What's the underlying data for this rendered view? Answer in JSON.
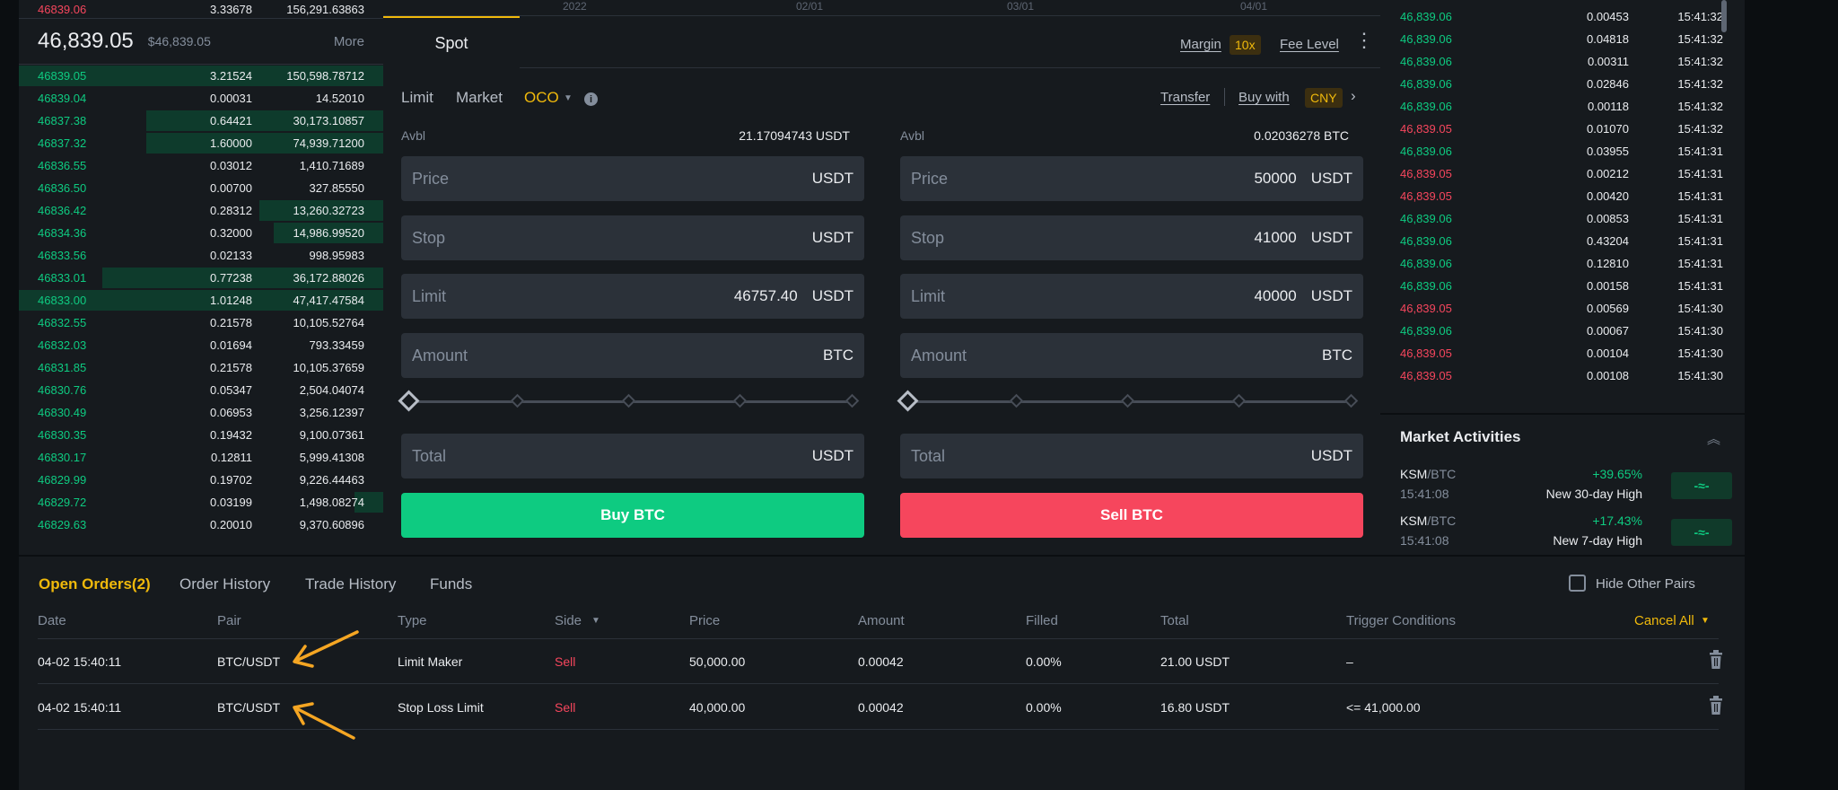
{
  "orderbook": {
    "top_ask": {
      "price": "46839.06",
      "qty": "3.33678",
      "total": "156,291.63863"
    },
    "last_price": "46,839.05",
    "last_price_usd": "$46,839.05",
    "more_label": "More",
    "bids": [
      {
        "price": "46839.05",
        "qty": "3.21524",
        "total": "150,598.78712",
        "depth": 1.0
      },
      {
        "price": "46839.04",
        "qty": "0.00031",
        "total": "14.52010",
        "depth": 0.0
      },
      {
        "price": "46837.38",
        "qty": "0.64421",
        "total": "30,173.10857",
        "depth": 0.65
      },
      {
        "price": "46837.32",
        "qty": "1.60000",
        "total": "74,939.71200",
        "depth": 0.65
      },
      {
        "price": "46836.55",
        "qty": "0.03012",
        "total": "1,410.71689",
        "depth": 0.0
      },
      {
        "price": "46836.50",
        "qty": "0.00700",
        "total": "327.85550",
        "depth": 0.0
      },
      {
        "price": "46836.42",
        "qty": "0.28312",
        "total": "13,260.32723",
        "depth": 0.34
      },
      {
        "price": "46834.36",
        "qty": "0.32000",
        "total": "14,986.99520",
        "depth": 0.3
      },
      {
        "price": "46833.56",
        "qty": "0.02133",
        "total": "998.95983",
        "depth": 0.0
      },
      {
        "price": "46833.01",
        "qty": "0.77238",
        "total": "36,172.88026",
        "depth": 0.77
      },
      {
        "price": "46833.00",
        "qty": "1.01248",
        "total": "47,417.47584",
        "depth": 1.0
      },
      {
        "price": "46832.55",
        "qty": "0.21578",
        "total": "10,105.52764",
        "depth": 0.0
      },
      {
        "price": "46832.03",
        "qty": "0.01694",
        "total": "793.33459",
        "depth": 0.0
      },
      {
        "price": "46831.85",
        "qty": "0.21578",
        "total": "10,105.37659",
        "depth": 0.0
      },
      {
        "price": "46830.76",
        "qty": "0.05347",
        "total": "2,504.04074",
        "depth": 0.0
      },
      {
        "price": "46830.49",
        "qty": "0.06953",
        "total": "3,256.12397",
        "depth": 0.0
      },
      {
        "price": "46830.35",
        "qty": "0.19432",
        "total": "9,100.07361",
        "depth": 0.0
      },
      {
        "price": "46830.17",
        "qty": "0.12811",
        "total": "5,999.41308",
        "depth": 0.0
      },
      {
        "price": "46829.99",
        "qty": "0.19702",
        "total": "9,226.44463",
        "depth": 0.0
      },
      {
        "price": "46829.72",
        "qty": "0.03199",
        "total": "1,498.08274",
        "depth": 0.08
      },
      {
        "price": "46829.63",
        "qty": "0.20010",
        "total": "9,370.60896",
        "depth": 0.0
      }
    ]
  },
  "chart_strip": {
    "labels": [
      "2022",
      "02/01",
      "03/01",
      "04/01"
    ]
  },
  "form": {
    "tab_spot": "Spot",
    "margin_label": "Margin",
    "margin_badge": "10x",
    "fee_level_label": "Fee Level",
    "order_types": {
      "limit": "Limit",
      "market": "Market",
      "oco": "OCO"
    },
    "transfer_label": "Transfer",
    "buy_with_label": "Buy with",
    "buy_with_currency": "CNY",
    "buy": {
      "avbl_label": "Avbl",
      "avbl_value": "21.17094743 USDT",
      "price": {
        "label": "Price",
        "value": "",
        "unit": "USDT"
      },
      "stop": {
        "label": "Stop",
        "value": "",
        "unit": "USDT"
      },
      "limit": {
        "label": "Limit",
        "value": "46757.40",
        "unit": "USDT"
      },
      "amount": {
        "label": "Amount",
        "value": "",
        "unit": "BTC"
      },
      "total": {
        "label": "Total",
        "value": "",
        "unit": "USDT"
      },
      "button": "Buy BTC",
      "slider_value": 0
    },
    "sell": {
      "avbl_label": "Avbl",
      "avbl_value": "0.02036278 BTC",
      "price": {
        "label": "Price",
        "value": "50000",
        "unit": "USDT"
      },
      "stop": {
        "label": "Stop",
        "value": "41000",
        "unit": "USDT"
      },
      "limit": {
        "label": "Limit",
        "value": "40000",
        "unit": "USDT"
      },
      "amount": {
        "label": "Amount",
        "value": "",
        "unit": "BTC"
      },
      "total": {
        "label": "Total",
        "value": "",
        "unit": "USDT"
      },
      "button": "Sell BTC",
      "slider_value": 0
    }
  },
  "trades": [
    {
      "price": "46,839.06",
      "qty": "0.00453",
      "time": "15:41:32",
      "side": "buy"
    },
    {
      "price": "46,839.06",
      "qty": "0.04818",
      "time": "15:41:32",
      "side": "buy"
    },
    {
      "price": "46,839.06",
      "qty": "0.00311",
      "time": "15:41:32",
      "side": "buy"
    },
    {
      "price": "46,839.06",
      "qty": "0.02846",
      "time": "15:41:32",
      "side": "buy"
    },
    {
      "price": "46,839.06",
      "qty": "0.00118",
      "time": "15:41:32",
      "side": "buy"
    },
    {
      "price": "46,839.05",
      "qty": "0.01070",
      "time": "15:41:32",
      "side": "sell"
    },
    {
      "price": "46,839.06",
      "qty": "0.03955",
      "time": "15:41:31",
      "side": "buy"
    },
    {
      "price": "46,839.05",
      "qty": "0.00212",
      "time": "15:41:31",
      "side": "sell"
    },
    {
      "price": "46,839.05",
      "qty": "0.00420",
      "time": "15:41:31",
      "side": "sell"
    },
    {
      "price": "46,839.06",
      "qty": "0.00853",
      "time": "15:41:31",
      "side": "buy"
    },
    {
      "price": "46,839.06",
      "qty": "0.43204",
      "time": "15:41:31",
      "side": "buy"
    },
    {
      "price": "46,839.06",
      "qty": "0.12810",
      "time": "15:41:31",
      "side": "buy"
    },
    {
      "price": "46,839.06",
      "qty": "0.00158",
      "time": "15:41:31",
      "side": "buy"
    },
    {
      "price": "46,839.05",
      "qty": "0.00569",
      "time": "15:41:30",
      "side": "sell"
    },
    {
      "price": "46,839.06",
      "qty": "0.00067",
      "time": "15:41:30",
      "side": "buy"
    },
    {
      "price": "46,839.05",
      "qty": "0.00104",
      "time": "15:41:30",
      "side": "sell"
    },
    {
      "price": "46,839.05",
      "qty": "0.00108",
      "time": "15:41:30",
      "side": "sell"
    }
  ],
  "market": {
    "title": "Market Activities",
    "items": [
      {
        "base": "KSM",
        "quote": "/BTC",
        "time": "15:41:08",
        "change": "+39.65%",
        "desc": "New 30-day High"
      },
      {
        "base": "KSM",
        "quote": "/BTC",
        "time": "15:41:08",
        "change": "+17.43%",
        "desc": "New 7-day High"
      }
    ]
  },
  "orders": {
    "tabs": [
      "Open Orders(2)",
      "Order History",
      "Trade History",
      "Funds"
    ],
    "hide_other_pairs": "Hide Other Pairs",
    "columns": [
      "Date",
      "Pair",
      "Type",
      "Side",
      "Price",
      "Amount",
      "Filled",
      "Total",
      "Trigger Conditions"
    ],
    "cancel_all": "Cancel All",
    "rows": [
      {
        "date": "04-02 15:40:11",
        "pair": "BTC/USDT",
        "type": "Limit Maker",
        "side": "Sell",
        "price": "50,000.00",
        "amount": "0.00042",
        "filled": "0.00%",
        "total": "21.00 USDT",
        "trigger": "–"
      },
      {
        "date": "04-02 15:40:11",
        "pair": "BTC/USDT",
        "type": "Stop Loss Limit",
        "side": "Sell",
        "price": "40,000.00",
        "amount": "0.00042",
        "filled": "0.00%",
        "total": "16.80 USDT",
        "trigger": "<= 41,000.00"
      }
    ]
  },
  "colors": {
    "green": "#0ecb81",
    "red": "#f6465d",
    "accent": "#f0b90b",
    "annotation": "#f5a623"
  }
}
